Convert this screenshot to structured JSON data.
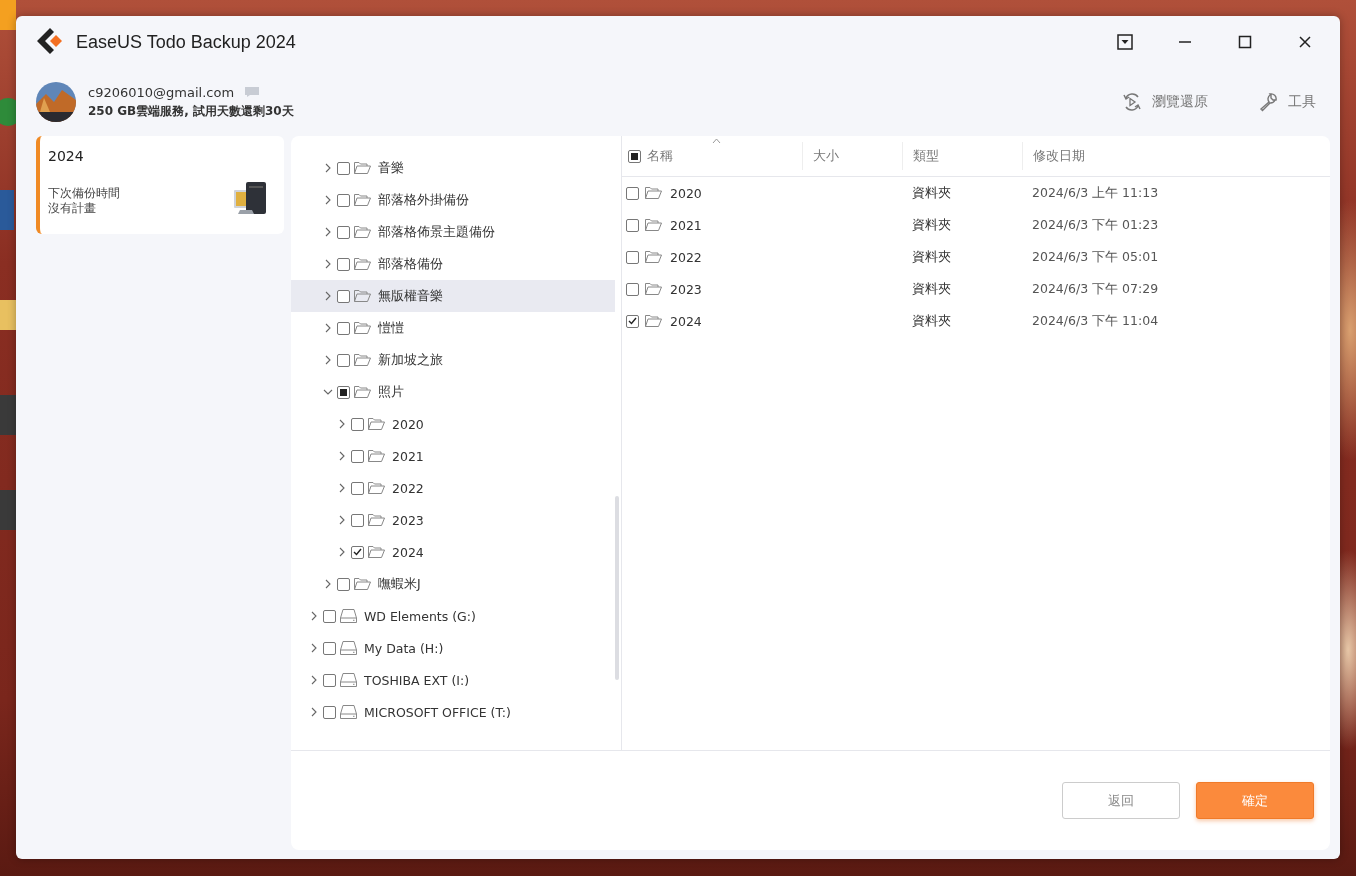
{
  "window": {
    "title": "EaseUS Todo Backup 2024"
  },
  "account": {
    "email": "c9206010@gmail.com",
    "storage": "250 GB雲端服務, 試用天數還剩30天"
  },
  "header_actions": [
    {
      "label": "瀏覽還原",
      "kind": "restore"
    },
    {
      "label": "工具",
      "kind": "tools"
    }
  ],
  "plans": [
    {
      "title": "2024",
      "next_label": "下次備份時間",
      "schedule": "沒有計畫",
      "selected": true
    }
  ],
  "tree": {
    "folders": [
      {
        "label": "音樂",
        "expanded": false,
        "checked": false,
        "highlighted": false
      },
      {
        "label": "部落格外掛備份",
        "expanded": false,
        "checked": false,
        "highlighted": false
      },
      {
        "label": "部落格佈景主題備份",
        "expanded": false,
        "checked": false,
        "highlighted": false
      },
      {
        "label": "部落格備份",
        "expanded": false,
        "checked": false,
        "highlighted": false
      },
      {
        "label": "無版權音樂",
        "expanded": false,
        "checked": false,
        "highlighted": true
      },
      {
        "label": "愷愷",
        "expanded": false,
        "checked": false,
        "highlighted": false
      },
      {
        "label": "新加坡之旅",
        "expanded": false,
        "checked": false,
        "highlighted": false
      },
      {
        "label": "照片",
        "expanded": true,
        "checked": false,
        "partial": true,
        "highlighted": false,
        "children": [
          {
            "label": "2020",
            "expanded": false,
            "checked": false,
            "highlighted": false
          },
          {
            "label": "2021",
            "expanded": false,
            "checked": false,
            "highlighted": false
          },
          {
            "label": "2022",
            "expanded": false,
            "checked": false,
            "highlighted": false
          },
          {
            "label": "2023",
            "expanded": false,
            "checked": false,
            "highlighted": false
          },
          {
            "label": "2024",
            "expanded": false,
            "checked": true,
            "highlighted": false
          }
        ]
      },
      {
        "label": "嘸蝦米J",
        "expanded": false,
        "checked": false,
        "highlighted": false
      }
    ],
    "drives": [
      {
        "label": "WD Elements (G:)",
        "expanded": false,
        "checked": false,
        "highlighted": false
      },
      {
        "label": "My Data (H:)",
        "expanded": false,
        "checked": false,
        "highlighted": false
      },
      {
        "label": "TOSHIBA EXT (I:)",
        "expanded": false,
        "checked": false,
        "highlighted": false
      },
      {
        "label": "MICROSOFT OFFICE (T:)",
        "expanded": false,
        "checked": false,
        "highlighted": false
      }
    ]
  },
  "table": {
    "all_checked": false,
    "all_partial": true,
    "columns": [
      "名稱",
      "大小",
      "類型",
      "修改日期"
    ],
    "rows": [
      {
        "name": "2020",
        "type": "資料夾",
        "modified": "2024/6/3 上午 11:13",
        "checked": false
      },
      {
        "name": "2021",
        "type": "資料夾",
        "modified": "2024/6/3 下午 01:23",
        "checked": false
      },
      {
        "name": "2022",
        "type": "資料夾",
        "modified": "2024/6/3 下午 05:01",
        "checked": false
      },
      {
        "name": "2023",
        "type": "資料夾",
        "modified": "2024/6/3 下午 07:29",
        "checked": false
      },
      {
        "name": "2024",
        "type": "資料夾",
        "modified": "2024/6/3 下午 11:04",
        "checked": true
      }
    ]
  },
  "buttons": [
    {
      "label": "返回",
      "kind": "secondary"
    },
    {
      "label": "確定",
      "kind": "primary"
    }
  ]
}
